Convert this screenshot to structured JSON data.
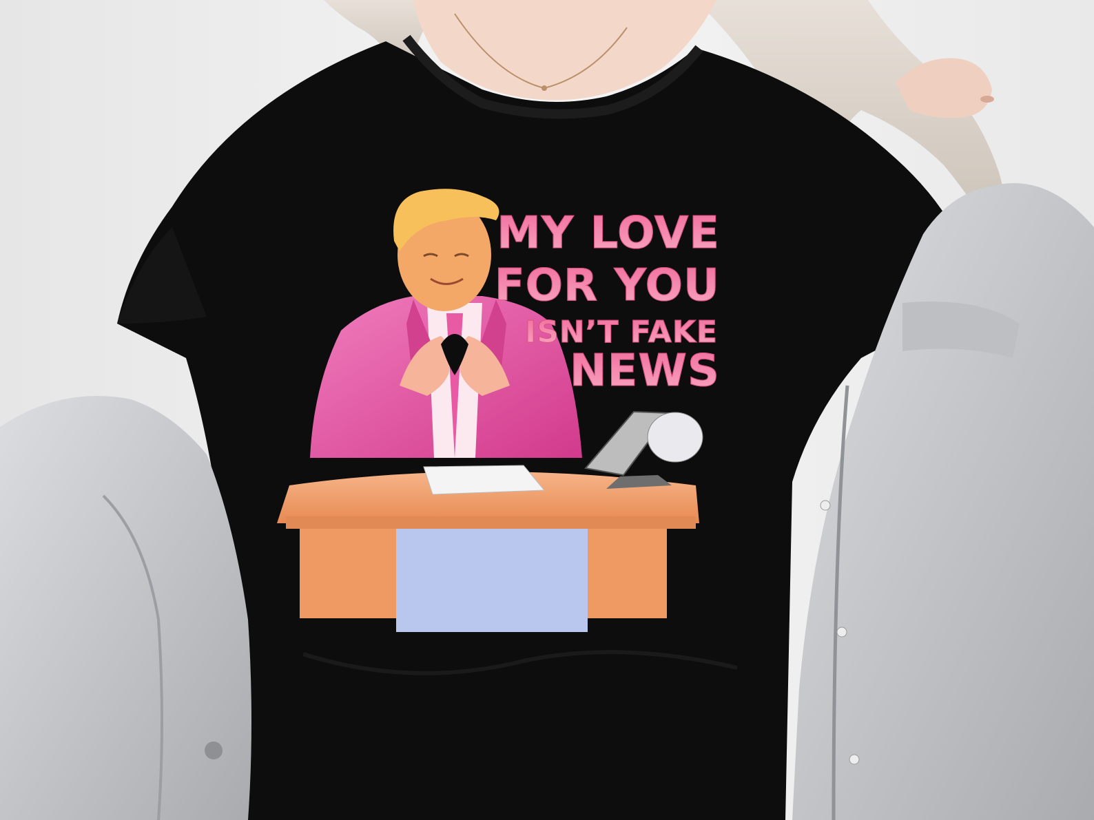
{
  "shirt": {
    "color": "#0d0d0d",
    "print": {
      "lines": [
        "MY LOVE",
        "FOR YOU",
        "ISN’T FAKE",
        "NEWS"
      ],
      "text_color": "#f06c9b",
      "text_color_light": "#f9a9c4",
      "suit_color": "#e2469a",
      "desk_color": "#f0a06a",
      "desk_panel_color": "#b9c7ef"
    }
  },
  "jacket": {
    "color": "#c9cbce"
  },
  "hair": {
    "color": "#d9d0c6"
  },
  "skin": {
    "color": "#f3d7c8"
  }
}
